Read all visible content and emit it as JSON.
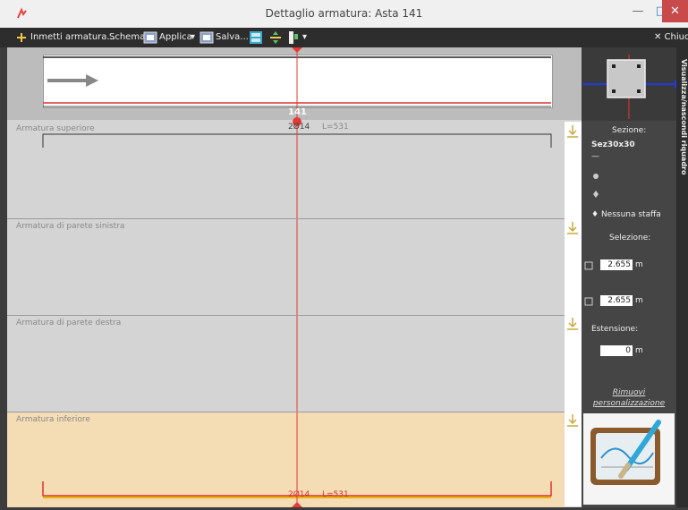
{
  "window": {
    "title": "Dettaglio armatura: Asta 141",
    "minimize_glyph": "—",
    "maximize_glyph": "□",
    "close_glyph": "✕"
  },
  "toolbar": {
    "insert_label": "Inmetti armatura...",
    "schema_label": "Schema",
    "applica_label": "Applica",
    "salva_label": "Salva...",
    "dropdown_glyph": "▾",
    "close_label": "✕ Chiudi"
  },
  "beam": {
    "bar_number": "141"
  },
  "sections": {
    "superiore": {
      "label": "Armatura superiore",
      "bars_text": "2Ø14",
      "length_text": "L=531"
    },
    "sinistra": {
      "label": "Armatura di parete sinistra"
    },
    "destra": {
      "label": "Armatura di parete destra"
    },
    "inferiore": {
      "label": "Armatura inferiore",
      "bars_text": "2Ø14",
      "length_text": "L=531"
    }
  },
  "sidebar": {
    "vertical_tab_label": "Visualizza/nascondi riquadro",
    "sezione_title": "Sezione:",
    "sezione_value": "Sez30x30",
    "sezione_dash": "—",
    "staffe_text": "Nessuna staffa",
    "selezione_title": "Selezione:",
    "sel_start_value": "2.655",
    "sel_end_value": "2.655",
    "unit": "m",
    "estensione_title": "Estensione:",
    "estensione_value": "0",
    "rimuovi_label": "Rimuovi personalizzazione"
  },
  "colors": {
    "rebar_red": "#e03030",
    "inferior_fill": "#f4dcb4",
    "arrow_blue": "#1f3ce0",
    "axis_red": "#e53935"
  },
  "icons": [
    "app-logo-icon",
    "insert-icon",
    "applica-icon",
    "salva-icon",
    "grid-icon",
    "split-icon",
    "column-icon",
    "download-icon",
    "section-icon",
    "gear-icon",
    "brush-icon",
    "calendar-icon"
  ]
}
